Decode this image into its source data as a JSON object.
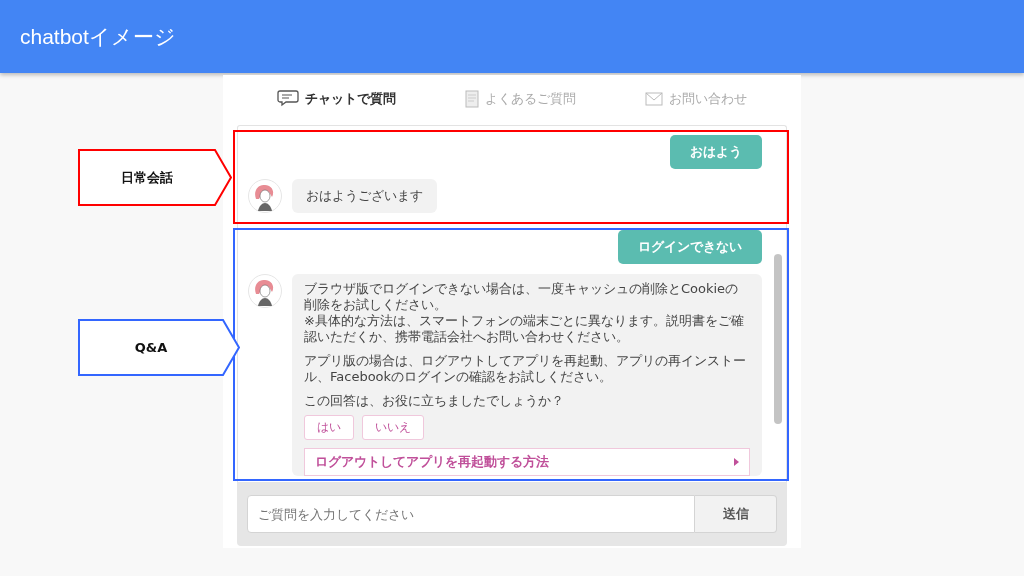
{
  "header": {
    "title": "chatbotイメージ"
  },
  "tabs": [
    {
      "label": "チャットで質問",
      "selected": true
    },
    {
      "label": "よくあるご質問",
      "selected": false
    },
    {
      "label": "お問い合わせ",
      "selected": false
    }
  ],
  "messages": [
    {
      "kind": "user",
      "text": "おはよう"
    },
    {
      "kind": "bot",
      "paragraphs": [
        "おはようございます"
      ]
    },
    {
      "kind": "user",
      "text": "ログインできない"
    },
    {
      "kind": "bot",
      "paragraphs": [
        "ブラウザ版でログインできない場合は、一度キャッシュの削除とCookieの削除をお試しください。\n※具体的な方法は、スマートフォンの端末ごとに異なります。説明書をご確認いただくか、携帯電話会社へお問い合わせください。",
        "アプリ版の場合は、ログアウトしてアプリを再起動、アプリの再インストール、Facebookのログインの確認をお試しください。",
        "この回答は、お役に立ちましたでしょうか？"
      ],
      "buttons": [
        "はい",
        "いいえ"
      ],
      "link": "ログアウトしてアプリを再起動する方法"
    }
  ],
  "input": {
    "placeholder": "ご質問を入力してください",
    "button": "送信"
  },
  "annotations": [
    {
      "label": "日常会話",
      "color": "#ff0000"
    },
    {
      "label": "Q&A",
      "color": "#3366ff"
    }
  ]
}
